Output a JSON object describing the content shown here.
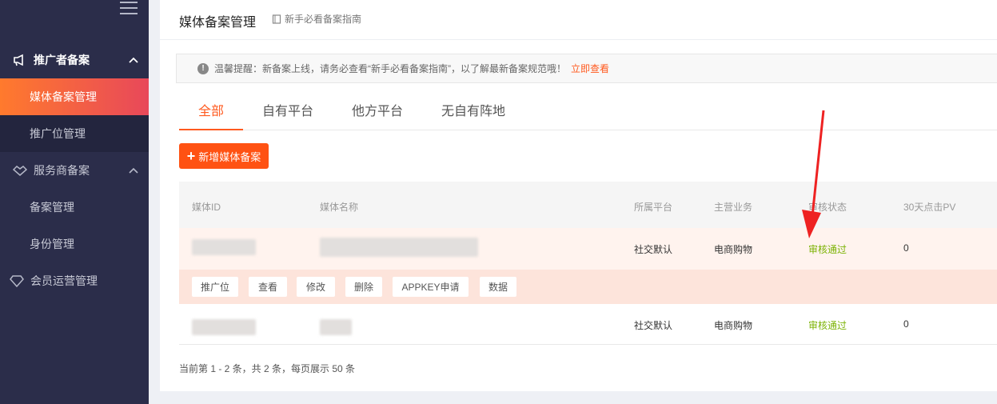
{
  "sidebar": {
    "groups": [
      {
        "label": "推广者备案",
        "icon": "megaphone-icon",
        "expanded": true
      },
      {
        "label": "服务商备案",
        "icon": "handshake-icon",
        "expanded": true
      },
      {
        "label": "会员运营管理",
        "icon": "diamond-icon",
        "expanded": false
      }
    ],
    "items": [
      {
        "label": "媒体备案管理",
        "selected": true
      },
      {
        "label": "推广位管理",
        "selected": false
      },
      {
        "label": "备案管理",
        "selected": false
      },
      {
        "label": "身份管理",
        "selected": false
      }
    ]
  },
  "header": {
    "title": "媒体备案管理",
    "guide_link": "新手必看备案指南"
  },
  "notice": {
    "text": "温馨提醒：新备案上线，请务必查看“新手必看备案指南”，以了解最新备案规范哦！",
    "link": "立即查看"
  },
  "tabs": [
    "全部",
    "自有平台",
    "他方平台",
    "无自有阵地"
  ],
  "active_tab": "全部",
  "add_button": "新增媒体备案",
  "table": {
    "columns": [
      "媒体ID",
      "媒体名称",
      "所属平台",
      "主营业务",
      "审核状态",
      "30天点击PV"
    ],
    "rows": [
      {
        "platform": "社交默认",
        "business": "电商购物",
        "status": "审核通过",
        "pv": "0"
      },
      {
        "platform": "社交默认",
        "business": "电商购物",
        "status": "审核通过",
        "pv": "0"
      }
    ],
    "actions": [
      "推广位",
      "查看",
      "修改",
      "删除",
      "APPKEY申请",
      "数据"
    ]
  },
  "pagination": "当前第 1 - 2 条，共 2 条，每页展示 50 条",
  "colors": {
    "accent": "#ff5213",
    "sidebar_bg": "#2b2d4a",
    "status_ok": "#7cb305",
    "arrow": "#ee2222"
  }
}
